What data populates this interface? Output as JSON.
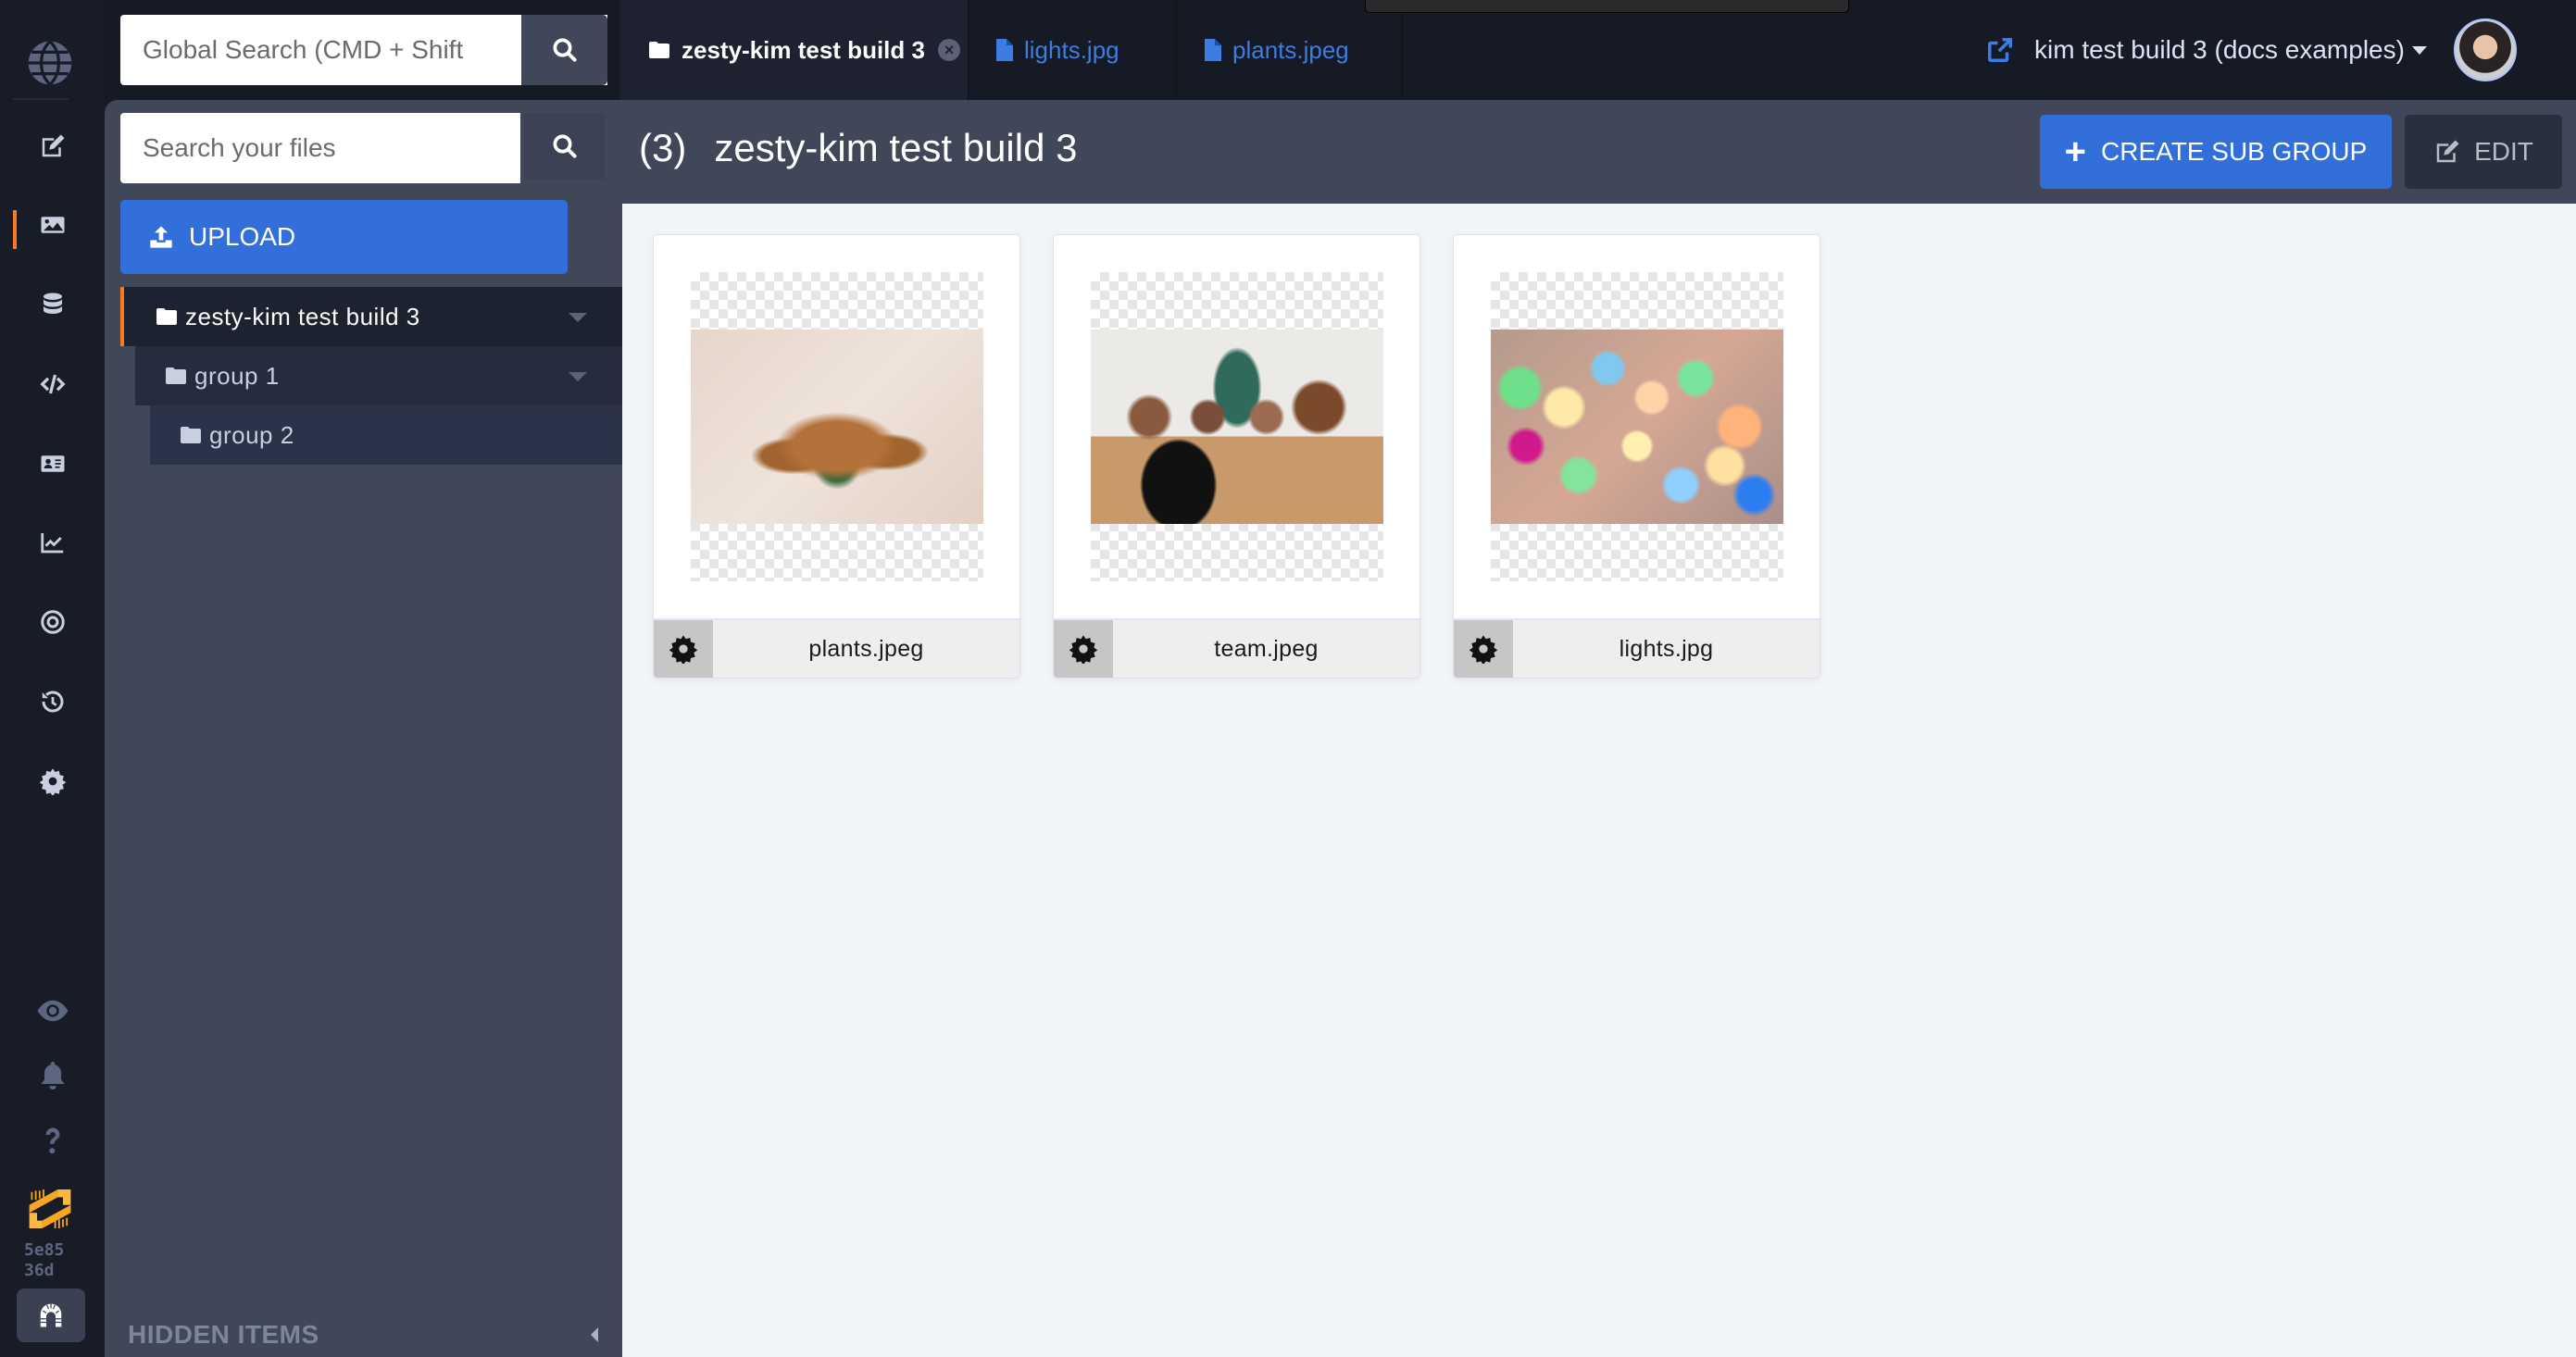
{
  "topbar": {
    "global_search_placeholder": "Global Search (CMD + Shift",
    "tabs": [
      {
        "label": "zesty-kim test build 3",
        "icon": "folder-icon",
        "active": true,
        "closable": true
      },
      {
        "label": "lights.jpg",
        "icon": "file-icon",
        "active": false
      },
      {
        "label": "plants.jpeg",
        "icon": "file-icon",
        "active": false
      }
    ],
    "account": {
      "instance_name": "kim test build 3 (docs examples)",
      "external_link_icon": "external-link-icon",
      "avatar_alt": "user avatar"
    }
  },
  "rail": {
    "items": [
      {
        "name": "content",
        "icon": "edit-icon"
      },
      {
        "name": "media",
        "icon": "image-icon",
        "active": true
      },
      {
        "name": "schema",
        "icon": "database-icon"
      },
      {
        "name": "code",
        "icon": "code-icon"
      },
      {
        "name": "leads",
        "icon": "address-card-icon"
      },
      {
        "name": "analytics",
        "icon": "chart-line-icon"
      },
      {
        "name": "seo",
        "icon": "target-icon"
      },
      {
        "name": "audit-trail",
        "icon": "history-icon"
      },
      {
        "name": "settings",
        "icon": "gear-icon"
      }
    ],
    "bottom": [
      {
        "name": "preview",
        "icon": "eye-icon"
      },
      {
        "name": "notifications",
        "icon": "bell-icon"
      },
      {
        "name": "help",
        "icon": "question-icon"
      }
    ],
    "build_hash": [
      "5e85",
      "36d"
    ]
  },
  "sidebar": {
    "search_placeholder": "Search your files",
    "upload_label": "UPLOAD",
    "tree": [
      {
        "label": "zesty-kim test build 3",
        "level": 0,
        "selected": true,
        "expandable": true
      },
      {
        "label": "group 1",
        "level": 1,
        "expandable": true
      },
      {
        "label": "group 2",
        "level": 2,
        "expandable": false
      }
    ],
    "hidden_items_label": "HIDDEN ITEMS"
  },
  "main": {
    "count": "(3)",
    "title": "zesty-kim test build 3",
    "create_button": "CREATE SUB GROUP",
    "edit_button": "EDIT",
    "files": [
      {
        "name": "plants.jpeg",
        "preview": "plants"
      },
      {
        "name": "team.jpeg",
        "preview": "team"
      },
      {
        "name": "lights.jpg",
        "preview": "lights"
      }
    ]
  },
  "colors": {
    "accent_orange": "#f97a1f",
    "primary_blue": "#326fd8",
    "link_blue": "#3d7ce3",
    "panel": "#404759",
    "rail": "#181c27",
    "content_bg": "#f1f5f9"
  }
}
